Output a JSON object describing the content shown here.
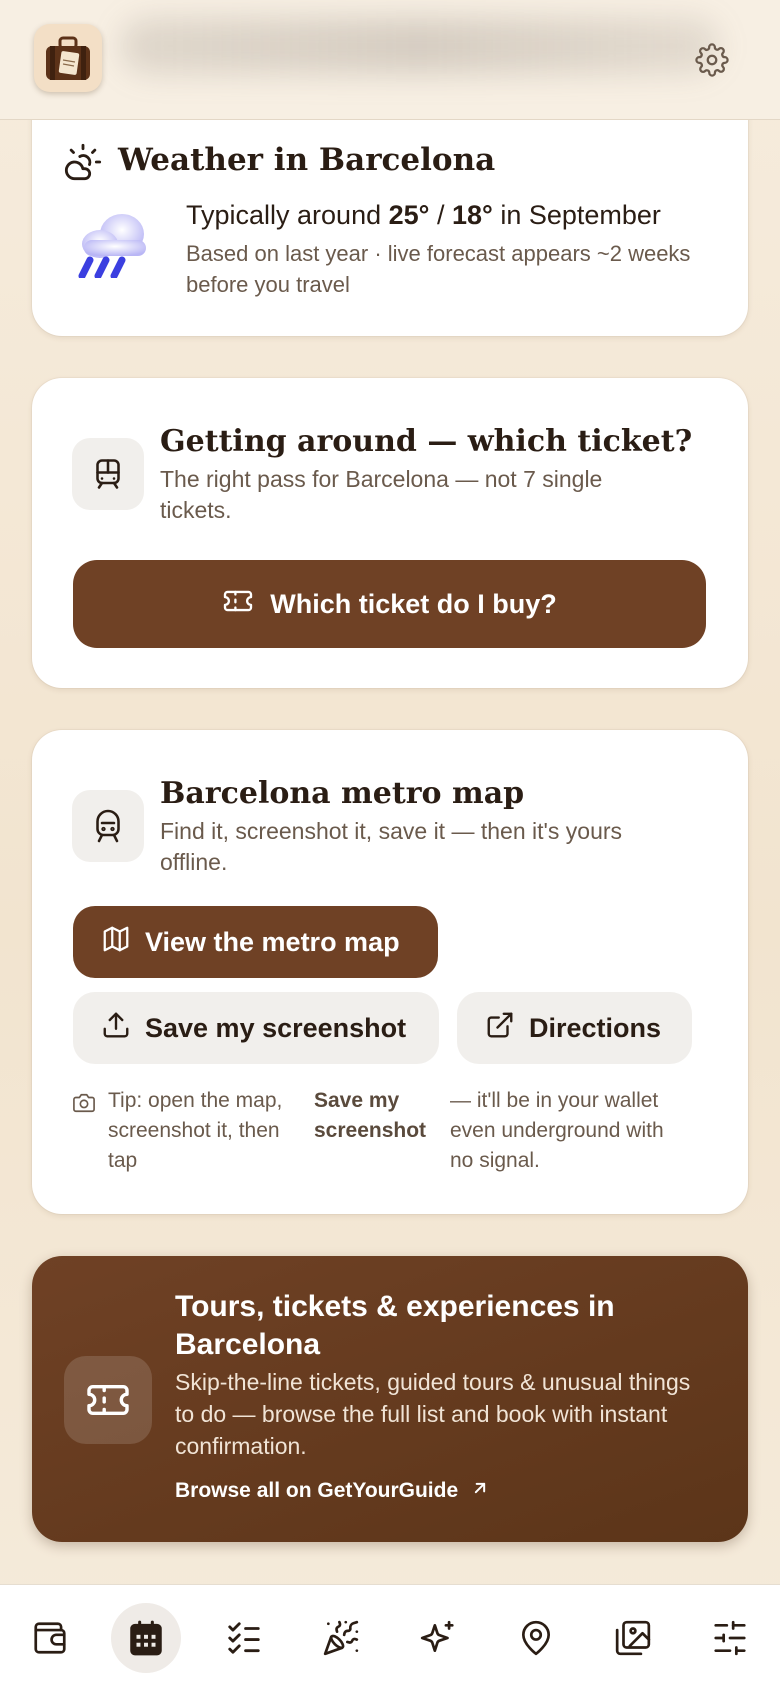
{
  "header": {
    "logo_icon": "suitcase-logo-icon",
    "settings_icon": "gear-icon"
  },
  "weather": {
    "icon": "sun-cloud-icon",
    "title": "Weather in Barcelona",
    "prefix": "Typically around ",
    "high": "25°",
    "separator": " / ",
    "low": "18°",
    "suffix": " in September",
    "note": "Based on last year · live forecast appears ~2 weeks before you travel",
    "condition_icon": "rain-cloud-icon"
  },
  "getting_around": {
    "title": "Getting around — which ticket?",
    "subtitle": "The right pass for Barcelona — not 7 single tickets.",
    "icon": "train-icon",
    "button_label": "Which ticket do I buy?",
    "button_icon": "ticket-icon"
  },
  "metro": {
    "title": "Barcelona metro map",
    "subtitle": "Find it, screenshot it, save it — then it's yours offline.",
    "icon": "metro-train-icon",
    "view_button": "View the metro map",
    "save_button": "Save my screenshot",
    "directions_button": "Directions",
    "tip_start": "Tip: open the map, screenshot it, then tap",
    "tip_bold": "Save my screenshot",
    "tip_end": "— it'll be in your wallet even underground with no signal."
  },
  "promo": {
    "title": "Tours, tickets & experiences in Barcelona",
    "description": "Skip-the-line tickets, guided tours & unusual things to do — browse the full list and book with instant confirmation.",
    "link_label": "Browse all on GetYourGuide",
    "icon": "ticket-icon"
  },
  "bottom_nav": {
    "items": [
      {
        "icon": "wallet-icon",
        "active": false
      },
      {
        "icon": "calendar-icon",
        "active": true
      },
      {
        "icon": "checklist-icon",
        "active": false
      },
      {
        "icon": "party-popper-icon",
        "active": false
      },
      {
        "icon": "sparkles-icon",
        "active": false
      },
      {
        "icon": "map-pin-icon",
        "active": false
      },
      {
        "icon": "photo-gallery-icon",
        "active": false
      },
      {
        "icon": "sliders-icon",
        "active": false
      }
    ]
  },
  "colors": {
    "accent_brown": "#6f4125",
    "background": "#f5ead8",
    "muted_text": "#6a5a4c",
    "rain_blue": "#3b3fe0"
  }
}
